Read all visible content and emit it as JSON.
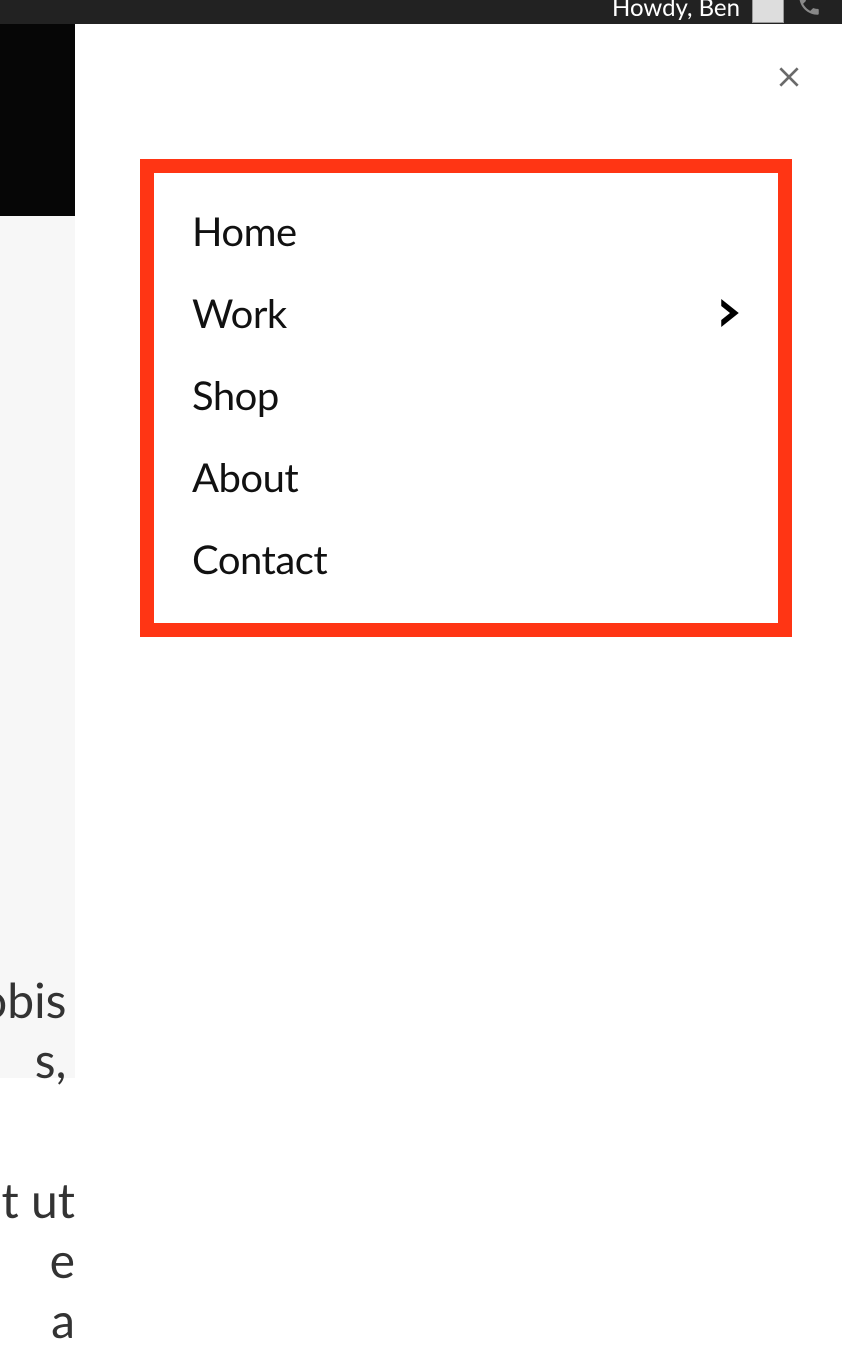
{
  "topbar": {
    "user_label": "Howdy, Ben"
  },
  "background": {
    "text_fragment_1a": "obis",
    "text_fragment_1b": "s,",
    "text_fragment_2a": "t ut e",
    "text_fragment_2b": "a"
  },
  "menu": {
    "items": [
      {
        "label": "Home",
        "has_submenu": false
      },
      {
        "label": "Work",
        "has_submenu": true
      },
      {
        "label": "Shop",
        "has_submenu": false
      },
      {
        "label": "About",
        "has_submenu": false
      },
      {
        "label": "Contact",
        "has_submenu": false
      }
    ]
  },
  "colors": {
    "highlight_border": "#ff3514",
    "dark_bg": "#060606"
  }
}
